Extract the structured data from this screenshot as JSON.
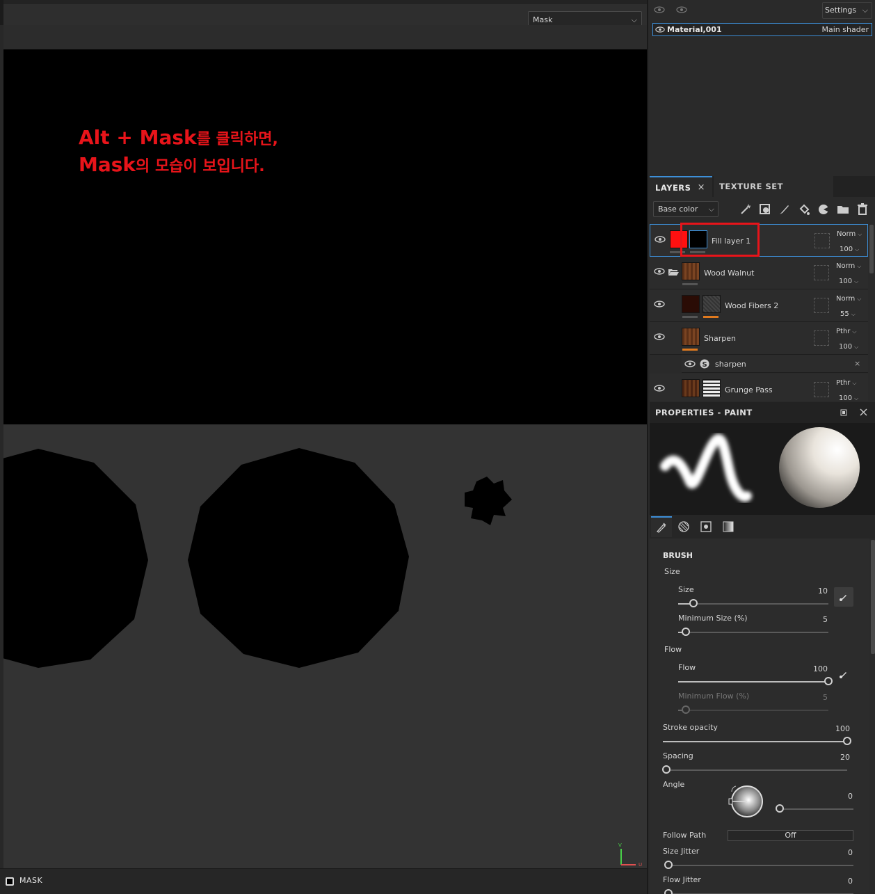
{
  "viewport": {
    "channel_select": "Mask",
    "annotation_line1_latin": "Alt + Mask",
    "annotation_line1_korean": "를 클릭하면,",
    "annotation_line2_latin": "Mask",
    "annotation_line2_korean": "의 모습이 보입니다.",
    "annotation_color": "#e8141a",
    "axis_v": "V",
    "axis_u": "U",
    "status_label": "MASK"
  },
  "texture_set": {
    "settings_label": "Settings",
    "material_name": "Material,001",
    "shader_name": "Main shader"
  },
  "layers_panel": {
    "tab_layers": "LAYERS",
    "tab_texture_set_settings": "TEXTURE SET SETTINGS",
    "channel": "Base color",
    "close": "×",
    "layers": [
      {
        "name": "Fill layer 1",
        "blend": "Norm",
        "opacity": "100"
      },
      {
        "name": "Wood Walnut",
        "blend": "Norm",
        "opacity": "100"
      },
      {
        "name": "Wood Fibers 2",
        "blend": "Norm",
        "opacity": "55"
      },
      {
        "name": "Sharpen",
        "blend": "Pthr",
        "opacity": "100"
      },
      {
        "name": "Grunge Pass",
        "blend": "Pthr",
        "opacity": "100"
      }
    ],
    "effect_name": "sharpen",
    "effect_close": "×"
  },
  "properties": {
    "title": "PROPERTIES - PAINT",
    "brush_heading": "BRUSH",
    "size_group": "Size",
    "size_label": "Size",
    "size_value": "10",
    "min_size_label": "Minimum Size (%)",
    "min_size_value": "5",
    "flow_group": "Flow",
    "flow_label": "Flow",
    "flow_value": "100",
    "min_flow_label": "Minimum Flow (%)",
    "min_flow_value": "5",
    "stroke_opacity_label": "Stroke opacity",
    "stroke_opacity_value": "100",
    "spacing_label": "Spacing",
    "spacing_value": "20",
    "angle_label": "Angle",
    "angle_value": "0",
    "follow_path_label": "Follow Path",
    "follow_path_value": "Off",
    "size_jitter_label": "Size Jitter",
    "size_jitter_value": "0",
    "flow_jitter_label": "Flow Jitter",
    "flow_jitter_value": "0",
    "slider_levels": {
      "size": 0.1,
      "min_size": 0.05,
      "flow": 1.0,
      "min_flow": 0.05,
      "stroke_opacity": 1.0,
      "spacing": 0.02,
      "angle": 0.0,
      "size_jitter": 0.0,
      "flow_jitter": 0.0
    }
  },
  "colors": {
    "accent": "#3d8fd8",
    "highlight": "#e8141a",
    "fill_swatch": "#ff1010",
    "orange_bar": "#e07a1f"
  }
}
